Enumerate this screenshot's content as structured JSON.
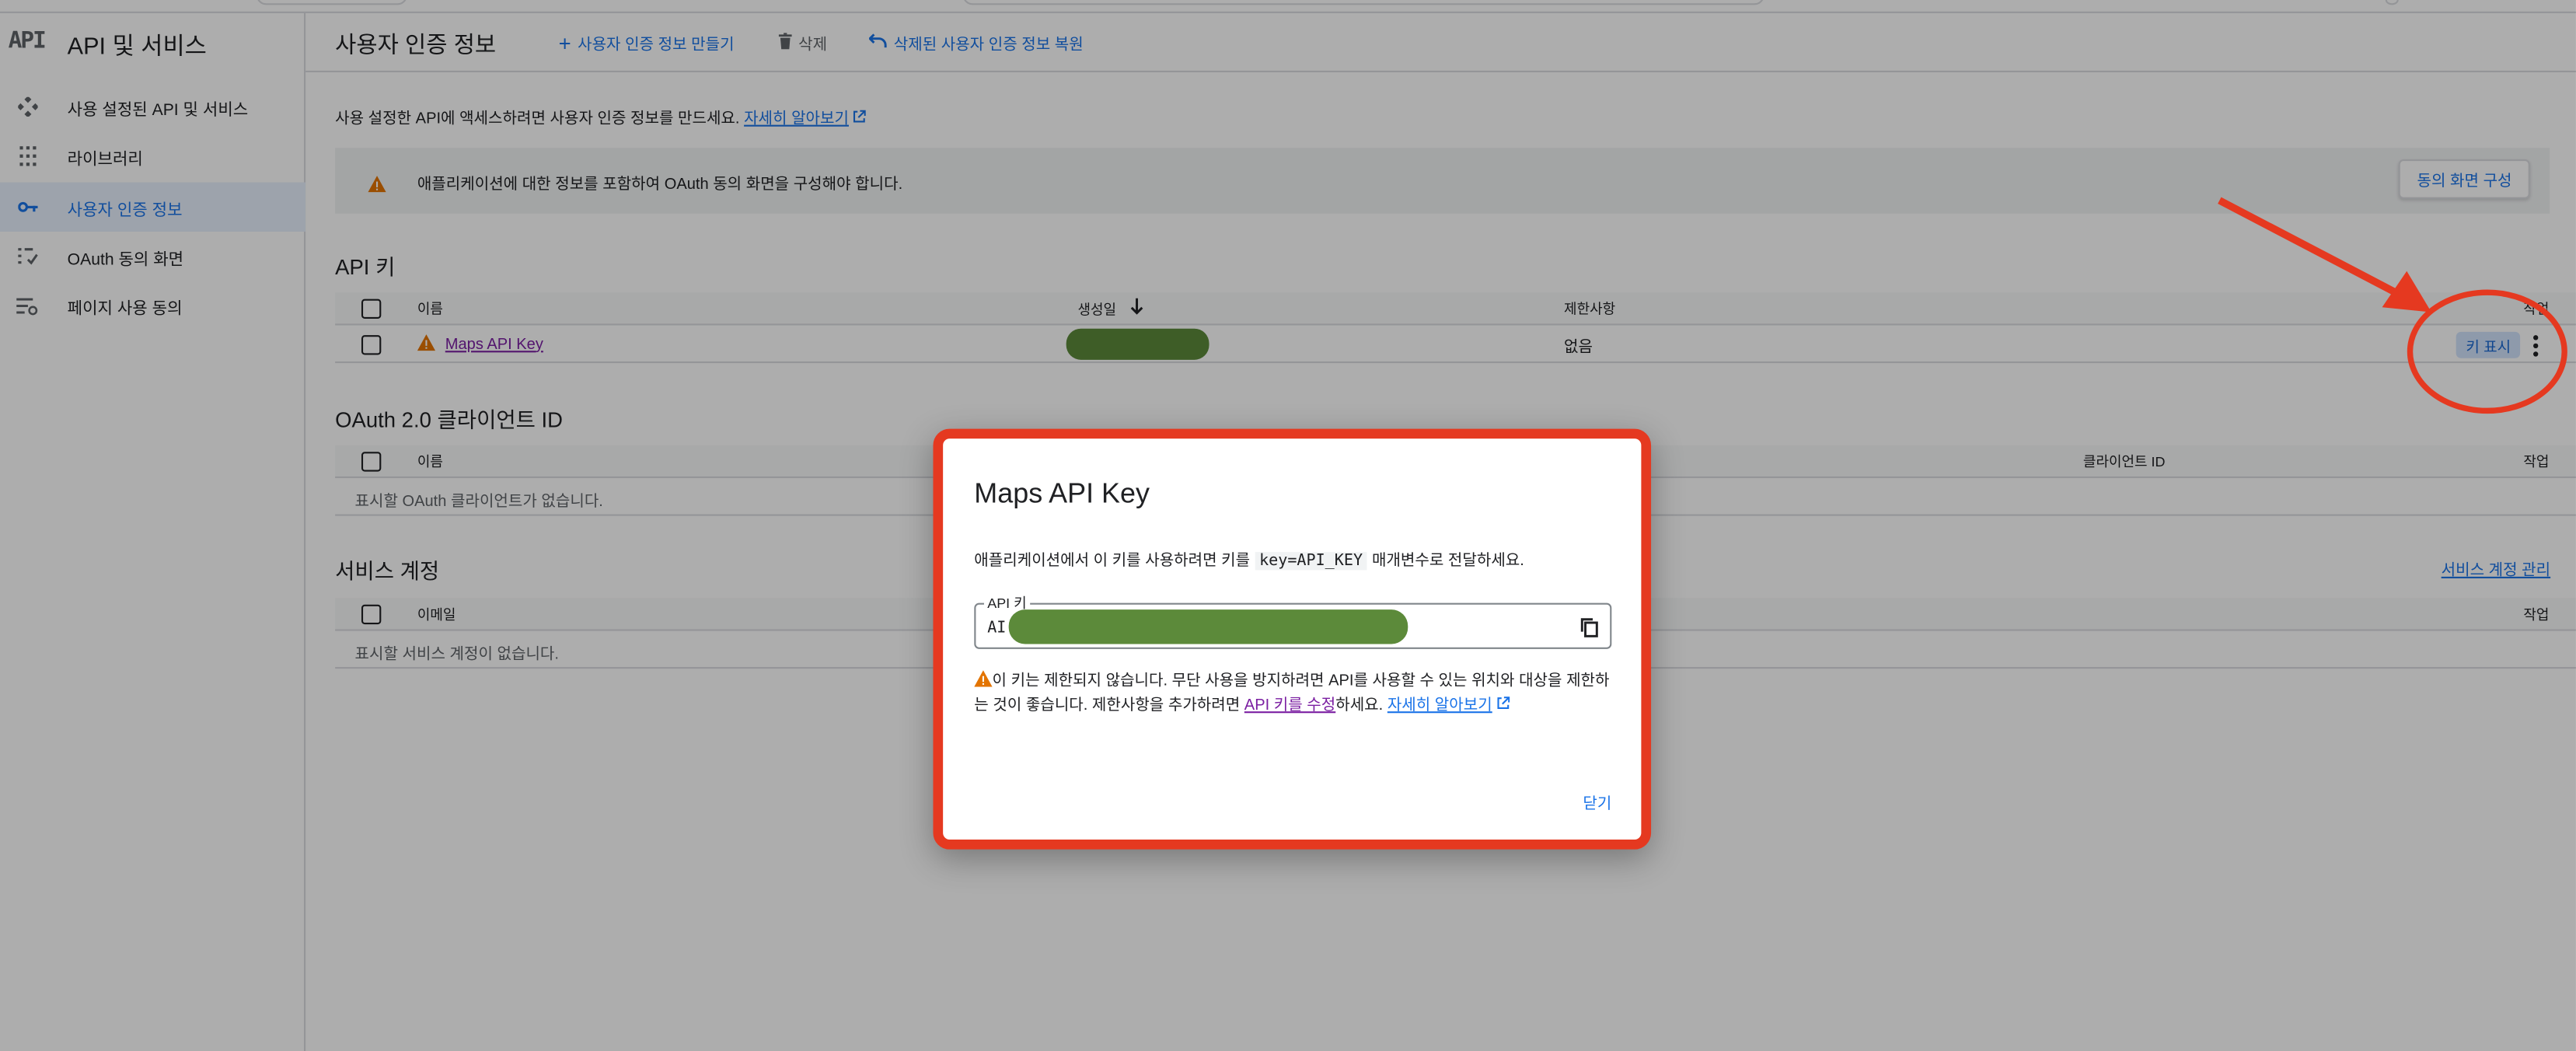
{
  "sidebar": {
    "logo": "API",
    "title": "API 및 서비스",
    "items": [
      {
        "label": "사용 설정된 API 및 서비스",
        "icon": "api-diamond-icon"
      },
      {
        "label": "라이브러리",
        "icon": "library-grid-icon"
      },
      {
        "label": "사용자 인증 정보",
        "icon": "key-icon",
        "active": true
      },
      {
        "label": "OAuth 동의 화면",
        "icon": "oauth-consent-icon"
      },
      {
        "label": "페이지 사용 동의",
        "icon": "page-consent-icon"
      }
    ]
  },
  "header": {
    "title": "사용자 인증 정보",
    "create_label": "사용자 인증 정보 만들기",
    "delete_label": "삭제",
    "restore_label": "삭제된 사용자 인증 정보 복원"
  },
  "intro": {
    "text": "사용 설정한 API에 액세스하려면 사용자 인증 정보를 만드세요.",
    "link": "자세히 알아보기"
  },
  "banner": {
    "text": "애플리케이션에 대한 정보를 포함하여 OAuth 동의 화면을 구성해야 합니다.",
    "button": "동의 화면 구성"
  },
  "api_keys": {
    "title": "API 키",
    "columns": {
      "name": "이름",
      "created": "생성일",
      "restrictions": "제한사항",
      "actions": "작업"
    },
    "rows": [
      {
        "name": "Maps API Key",
        "restrictions": "없음",
        "show_key": "키 표시"
      }
    ]
  },
  "oauth": {
    "title": "OAuth 2.0 클라이언트 ID",
    "columns": {
      "name": "이름",
      "client_id": "클라이언트 ID",
      "actions": "작업"
    },
    "empty": "표시할 OAuth 클라이언트가 없습니다."
  },
  "service_accounts": {
    "title": "서비스 계정",
    "manage_link": "서비스 계정 관리",
    "columns": {
      "email": "이메일",
      "actions": "작업"
    },
    "empty": "표시할 서비스 계정이 없습니다."
  },
  "dialog": {
    "title": "Maps API Key",
    "desc_before": "애플리케이션에서 이 키를 사용하려면 키를",
    "desc_code": "key=API_KEY",
    "desc_after": "매개변수로 전달하세요.",
    "field_label": "API 키",
    "field_value_prefix": "AI",
    "warning_text_1": "이 키는 제한되지 않습니다. 무단 사용을 방지하려면 API를 사용할 수 있는 위치와 대상을 제한하는 것이 좋습니다. 제한사항을 추가하려면 ",
    "warning_link_1": "API 키를 수정",
    "warning_text_2": "하세요. ",
    "warning_link_2": "자세히 알아보기",
    "close_label": "닫기"
  },
  "colors": {
    "accent": "#1a73e8",
    "annotation_red": "#e53920",
    "redaction_green": "#5c8a3a",
    "warning_orange": "#e37400"
  }
}
